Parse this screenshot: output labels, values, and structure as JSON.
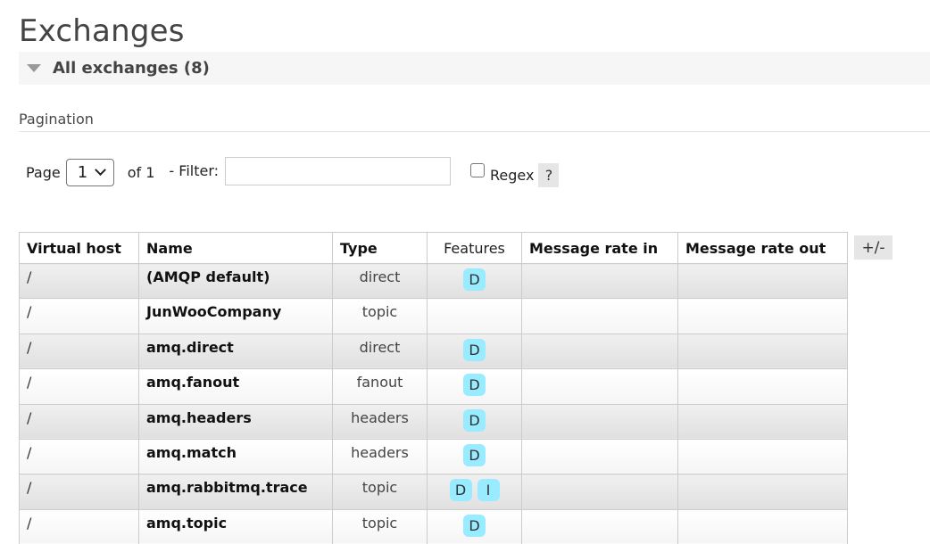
{
  "page": {
    "title": "Exchanges"
  },
  "section": {
    "title": "All exchanges (8)",
    "expanded": true
  },
  "pagination": {
    "heading": "Pagination",
    "page_label": "Page",
    "page_selected": "1",
    "of_label": "of 1",
    "filter_label": "- Filter:",
    "filter_value": "",
    "regex_label": "Regex",
    "regex_checked": false,
    "help_label": "?"
  },
  "table": {
    "columns": [
      "Virtual host",
      "Name",
      "Type",
      "Features",
      "Message rate in",
      "Message rate out"
    ],
    "toggle_columns_label": "+/-",
    "rows": [
      {
        "vhost": "/",
        "name": "(AMQP default)",
        "type": "direct",
        "features": [
          "D"
        ],
        "rate_in": "",
        "rate_out": ""
      },
      {
        "vhost": "/",
        "name": "JunWooCompany",
        "type": "topic",
        "features": [],
        "rate_in": "",
        "rate_out": ""
      },
      {
        "vhost": "/",
        "name": "amq.direct",
        "type": "direct",
        "features": [
          "D"
        ],
        "rate_in": "",
        "rate_out": ""
      },
      {
        "vhost": "/",
        "name": "amq.fanout",
        "type": "fanout",
        "features": [
          "D"
        ],
        "rate_in": "",
        "rate_out": ""
      },
      {
        "vhost": "/",
        "name": "amq.headers",
        "type": "headers",
        "features": [
          "D"
        ],
        "rate_in": "",
        "rate_out": ""
      },
      {
        "vhost": "/",
        "name": "amq.match",
        "type": "headers",
        "features": [
          "D"
        ],
        "rate_in": "",
        "rate_out": ""
      },
      {
        "vhost": "/",
        "name": "amq.rabbitmq.trace",
        "type": "topic",
        "features": [
          "D",
          "I"
        ],
        "rate_in": "",
        "rate_out": ""
      },
      {
        "vhost": "/",
        "name": "amq.topic",
        "type": "topic",
        "features": [
          "D"
        ],
        "rate_in": "",
        "rate_out": ""
      }
    ]
  },
  "colors": {
    "feature_badge": "#99ebff",
    "section_header_bg": "#f6f6f6",
    "button_bg": "#e6e6e6"
  }
}
